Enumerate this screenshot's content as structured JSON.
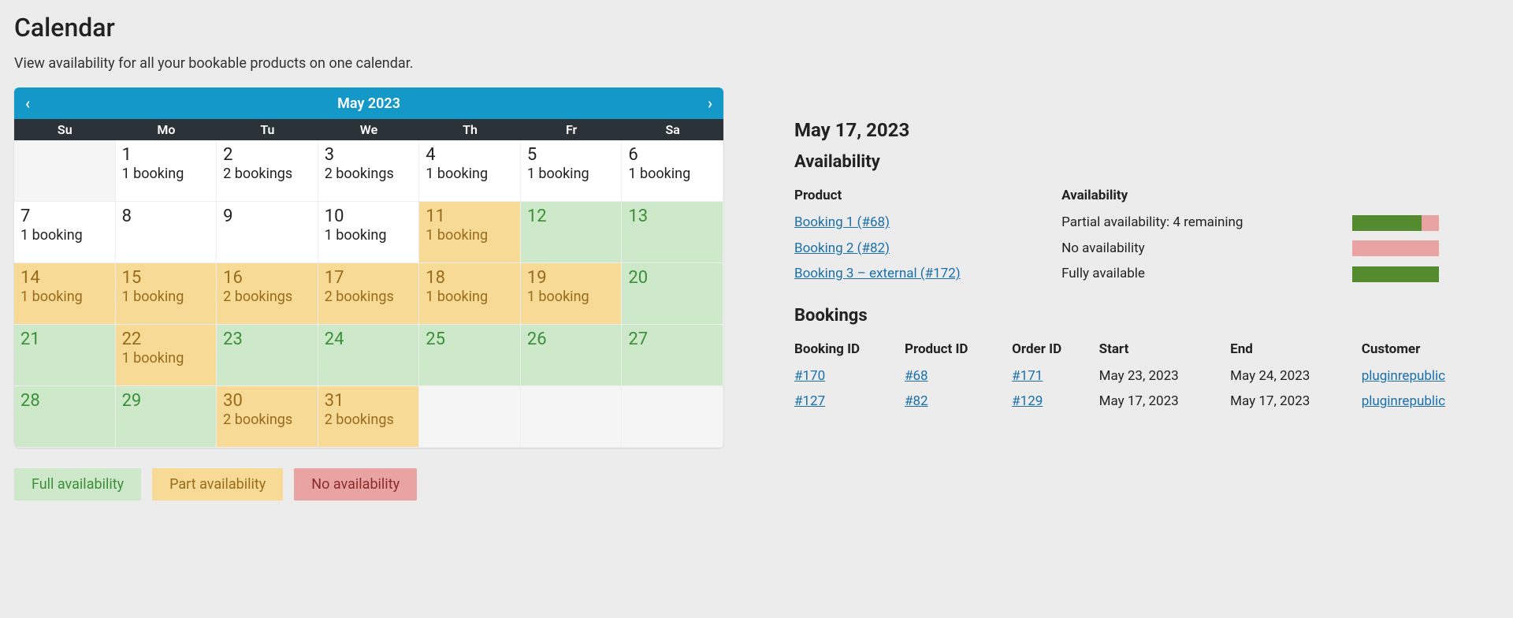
{
  "page": {
    "title": "Calendar",
    "subtitle": "View availability for all your bookable products on one calendar."
  },
  "calendar": {
    "month_label": "May 2023",
    "dow": [
      "Su",
      "Mo",
      "Tu",
      "We",
      "Th",
      "Fr",
      "Sa"
    ],
    "cells": [
      {
        "blank": true
      },
      {
        "day": "1",
        "sub": "1 booking",
        "cls": ""
      },
      {
        "day": "2",
        "sub": "2 bookings",
        "cls": ""
      },
      {
        "day": "3",
        "sub": "2 bookings",
        "cls": ""
      },
      {
        "day": "4",
        "sub": "1 booking",
        "cls": ""
      },
      {
        "day": "5",
        "sub": "1 booking",
        "cls": ""
      },
      {
        "day": "6",
        "sub": "1 booking",
        "cls": ""
      },
      {
        "day": "7",
        "sub": "1 booking",
        "cls": ""
      },
      {
        "day": "8",
        "sub": "",
        "cls": ""
      },
      {
        "day": "9",
        "sub": "",
        "cls": ""
      },
      {
        "day": "10",
        "sub": "1 booking",
        "cls": ""
      },
      {
        "day": "11",
        "sub": "1 booking",
        "cls": "part"
      },
      {
        "day": "12",
        "sub": "",
        "cls": "full"
      },
      {
        "day": "13",
        "sub": "",
        "cls": "full"
      },
      {
        "day": "14",
        "sub": "1 booking",
        "cls": "part"
      },
      {
        "day": "15",
        "sub": "1 booking",
        "cls": "part"
      },
      {
        "day": "16",
        "sub": "2 bookings",
        "cls": "part"
      },
      {
        "day": "17",
        "sub": "2 bookings",
        "cls": "part"
      },
      {
        "day": "18",
        "sub": "1 booking",
        "cls": "part"
      },
      {
        "day": "19",
        "sub": "1 booking",
        "cls": "part"
      },
      {
        "day": "20",
        "sub": "",
        "cls": "full"
      },
      {
        "day": "21",
        "sub": "",
        "cls": "full"
      },
      {
        "day": "22",
        "sub": "1 booking",
        "cls": "part"
      },
      {
        "day": "23",
        "sub": "",
        "cls": "full"
      },
      {
        "day": "24",
        "sub": "",
        "cls": "full"
      },
      {
        "day": "25",
        "sub": "",
        "cls": "full"
      },
      {
        "day": "26",
        "sub": "",
        "cls": "full"
      },
      {
        "day": "27",
        "sub": "",
        "cls": "full"
      },
      {
        "day": "28",
        "sub": "",
        "cls": "full"
      },
      {
        "day": "29",
        "sub": "",
        "cls": "full"
      },
      {
        "day": "30",
        "sub": "2 bookings",
        "cls": "part"
      },
      {
        "day": "31",
        "sub": "2 bookings",
        "cls": "part"
      },
      {
        "blank": true
      },
      {
        "blank": true
      },
      {
        "blank": true
      }
    ]
  },
  "legend": {
    "full": "Full availability",
    "part": "Part availability",
    "none": "No availability"
  },
  "detail": {
    "date": "May 17, 2023",
    "availability_heading": "Availability",
    "bookings_heading": "Bookings",
    "avail_headers": {
      "product": "Product",
      "availability": "Availability"
    },
    "availability": [
      {
        "product": "Booking 1 (#68)",
        "text": "Partial availability: 4 remaining",
        "pct": 80
      },
      {
        "product": "Booking 2 (#82)",
        "text": "No availability",
        "pct": 0
      },
      {
        "product": "Booking 3 – external (#172)",
        "text": "Fully available",
        "pct": 100
      }
    ],
    "book_headers": {
      "booking_id": "Booking ID",
      "product_id": "Product ID",
      "order_id": "Order ID",
      "start": "Start",
      "end": "End",
      "customer": "Customer"
    },
    "bookings": [
      {
        "booking_id": "#170",
        "product_id": "#68",
        "order_id": "#171",
        "start": "May 23, 2023",
        "end": "May 24, 2023",
        "customer": "pluginrepublic"
      },
      {
        "booking_id": "#127",
        "product_id": "#82",
        "order_id": "#129",
        "start": "May 17, 2023",
        "end": "May 17, 2023",
        "customer": "pluginrepublic"
      }
    ]
  }
}
